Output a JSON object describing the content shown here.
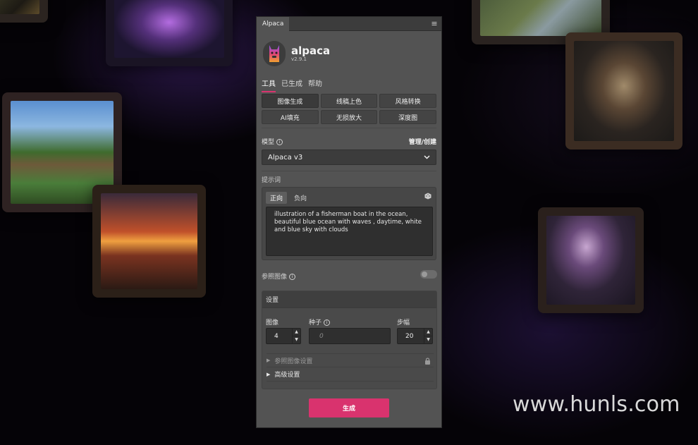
{
  "panel": {
    "tab_title": "Alpaca",
    "menu_icon": "hamburger-menu-icon",
    "app_name": "alpaca",
    "version": "v2.9.1",
    "logo_icon": "alpaca-llama-logo"
  },
  "nav_tabs": [
    {
      "label": "工具",
      "active": true
    },
    {
      "label": "已生成",
      "active": false
    },
    {
      "label": "帮助",
      "active": false
    }
  ],
  "tools": [
    {
      "label": "图像生成",
      "selected": true
    },
    {
      "label": "线稿上色",
      "selected": false
    },
    {
      "label": "风格转换",
      "selected": false
    },
    {
      "label": "AI填充",
      "selected": false
    },
    {
      "label": "无损放大",
      "selected": false
    },
    {
      "label": "深度图",
      "selected": false
    }
  ],
  "model": {
    "label": "模型",
    "manage_link": "管理/创建",
    "selected": "Alpaca v3"
  },
  "prompt": {
    "label": "提示词",
    "tab_positive": "正向",
    "tab_negative": "负向",
    "text": "illustration of a fisherman boat in the ocean, beautiful blue ocean with waves , daytime, white and blue sky with clouds"
  },
  "reference_image": {
    "label": "参照图像",
    "enabled": false
  },
  "settings": {
    "title": "设置",
    "images_label": "图像",
    "images_value": "4",
    "seed_label": "种子",
    "seed_placeholder": "0",
    "steps_label": "步幅",
    "steps_value": "20",
    "ref_image_settings": "参照图像设置",
    "advanced_settings": "高级设置"
  },
  "generate_button": "生成",
  "accent_color": "#d9336e",
  "watermark": "www.hunls.com"
}
